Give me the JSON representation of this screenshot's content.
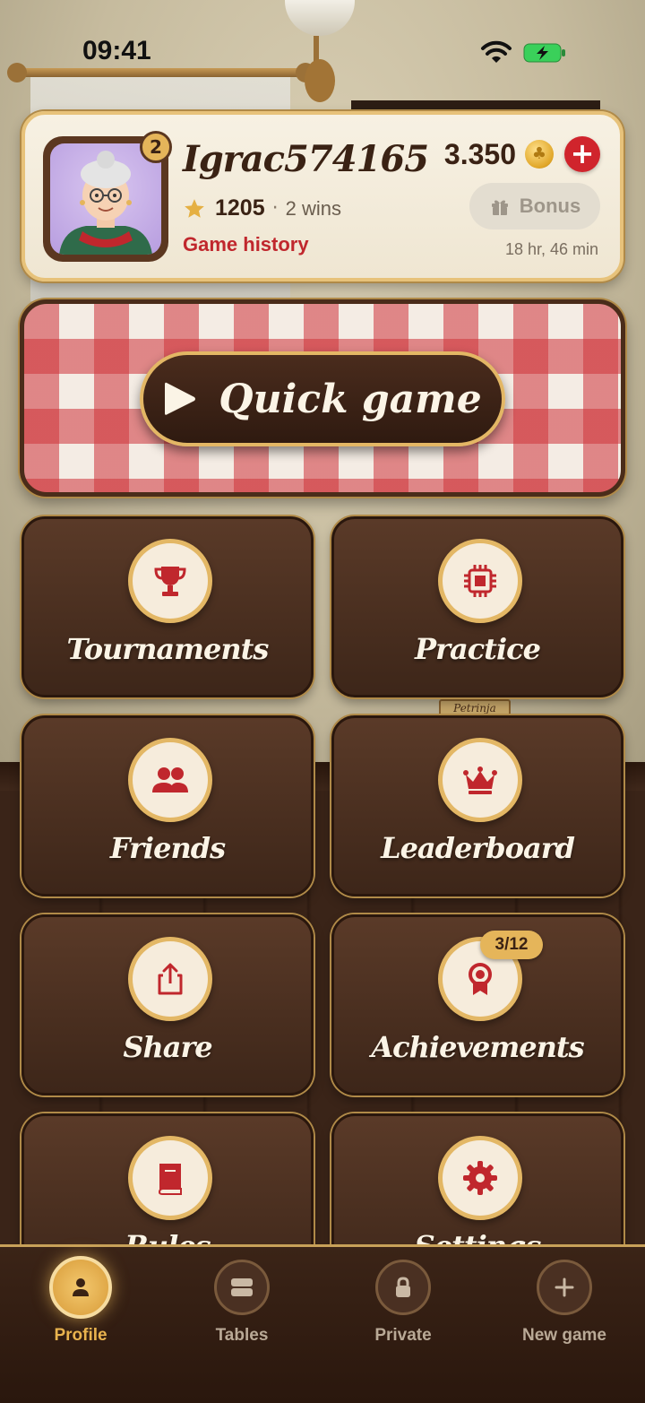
{
  "status_bar": {
    "time": "09:41"
  },
  "background": {
    "sign_text": "Petrinja"
  },
  "profile": {
    "username": "Igrac574165",
    "level": "2",
    "rating": "1205",
    "separator": "·",
    "wins": "2 wins",
    "game_history_label": "Game history",
    "coins": "3.350",
    "add_coins_label": "+",
    "bonus_label": "Bonus",
    "bonus_timer": "18 hr, 46 min"
  },
  "quick_game": {
    "label": "Quick game"
  },
  "menu": {
    "tiles": [
      {
        "label": "Tournaments",
        "icon": "trophy-icon"
      },
      {
        "label": "Practice",
        "icon": "chip-icon"
      },
      {
        "label": "Friends",
        "icon": "friends-icon"
      },
      {
        "label": "Leaderboard",
        "icon": "crown-icon"
      },
      {
        "label": "Share",
        "icon": "share-icon"
      },
      {
        "label": "Achievements",
        "icon": "ribbon-icon",
        "badge": "3/12"
      },
      {
        "label": "Rules",
        "icon": "book-icon"
      },
      {
        "label": "Settings",
        "icon": "gear-icon"
      }
    ]
  },
  "bottom_nav": {
    "items": [
      {
        "label": "Profile",
        "icon": "person-icon",
        "active": true
      },
      {
        "label": "Tables",
        "icon": "tables-icon",
        "active": false
      },
      {
        "label": "Private",
        "icon": "lock-icon",
        "active": false
      },
      {
        "label": "New game",
        "icon": "plus-icon",
        "active": false
      }
    ]
  },
  "colors": {
    "accent_red": "#c0272d",
    "gold": "#e5b55a",
    "wood_dark": "#3d2619",
    "cream": "#f6ecdc"
  }
}
